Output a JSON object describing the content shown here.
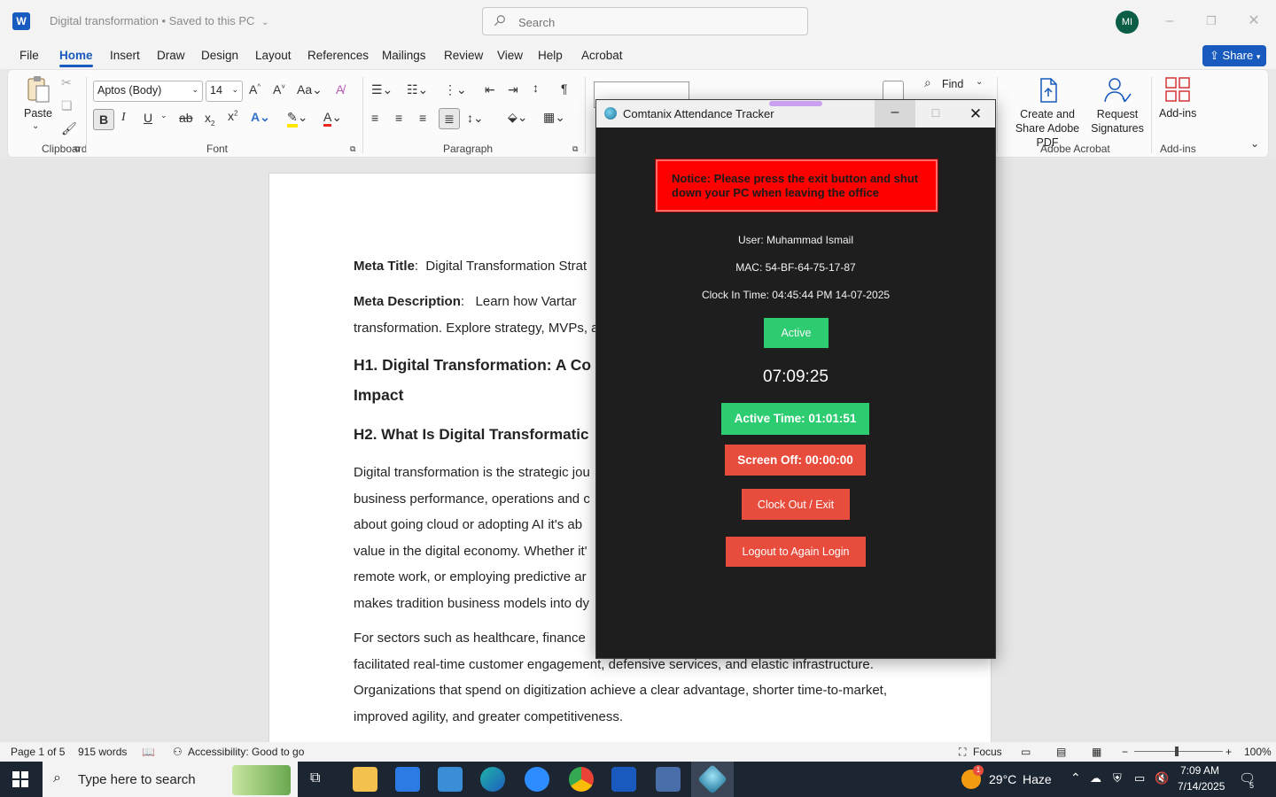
{
  "titlebar": {
    "doc_title": "Digital transformation • Saved to this PC",
    "search_placeholder": "Search",
    "avatar_initials": "MI"
  },
  "tabs": [
    "File",
    "Home",
    "Insert",
    "Draw",
    "Design",
    "Layout",
    "References",
    "Mailings",
    "Review",
    "View",
    "Help",
    "Acrobat"
  ],
  "active_tab": "Home",
  "share_label": "Share",
  "ribbon": {
    "paste_label": "Paste",
    "font_name": "Aptos (Body)",
    "font_size": "14",
    "find_label": "Find",
    "groups": {
      "clipboard": "Clipboard",
      "font": "Font",
      "paragraph": "Paragraph",
      "adobe": "Adobe Acrobat",
      "addins": "Add-ins"
    },
    "create_share_pdf": "Create and Share Adobe PDF",
    "request_signatures": "Request Signatures",
    "addins_label": "Add-ins"
  },
  "document": {
    "meta_title_label": "Meta Title",
    "meta_title_value": "Digital Transformation Strat",
    "meta_desc_label": "Meta Description",
    "meta_desc_line1": "Learn how Vartar",
    "meta_desc_line2": "transformation. Explore strategy, MVPs, a",
    "h1_line1": "H1. Digital Transformation: A Co",
    "h1_line2": "Impact",
    "h2": "H2. What Is Digital Transformatic",
    "para1_lines": [
      "Digital transformation is the strategic jou",
      "business performance, operations and c",
      "about going cloud or adopting AI it's ab",
      "value in the digital economy. Whether it'",
      "remote work, or employing predictive ar",
      "makes tradition business models into dy"
    ],
    "para2_lines": [
      "For sectors such as healthcare, finance",
      "facilitated real-time customer engagement, defensive services, and elastic infrastructure.",
      "Organizations that spend on digitization achieve a clear advantage, shorter time-to-market,",
      "improved agility, and greater competitiveness."
    ]
  },
  "statusbar": {
    "page": "Page 1 of 5",
    "words": "915 words",
    "accessibility": "Accessibility: Good to go",
    "focus": "Focus",
    "zoom": "100%"
  },
  "taskbar": {
    "search_placeholder": "Type here to search",
    "weather_temp": "29°C",
    "weather_desc": "Haze",
    "time": "7:09 AM",
    "date": "7/14/2025",
    "notifications": "5",
    "weather_badge": "1"
  },
  "tracker": {
    "title": "Comtanix Attendance Tracker",
    "notice": "Notice: Please press the exit button and shut down your PC when leaving the office",
    "user": "User: Muhammad Ismail",
    "mac": "MAC: 54-BF-64-75-17-87",
    "clock_in": "Clock In Time: 04:45:44 PM 14-07-2025",
    "status": "Active",
    "clock": "07:09:25",
    "active_time": "Active Time: 01:01:51",
    "screen_off": "Screen Off: 00:00:00",
    "clock_out_label": "Clock Out / Exit",
    "logout_label": "Logout to Again Login"
  },
  "colors": {
    "word_blue": "#185abd",
    "tracker_bg": "#1e1e1e",
    "active_green": "#2ecc71",
    "danger_red": "#e74c3c",
    "notice_red": "#ff0000"
  }
}
